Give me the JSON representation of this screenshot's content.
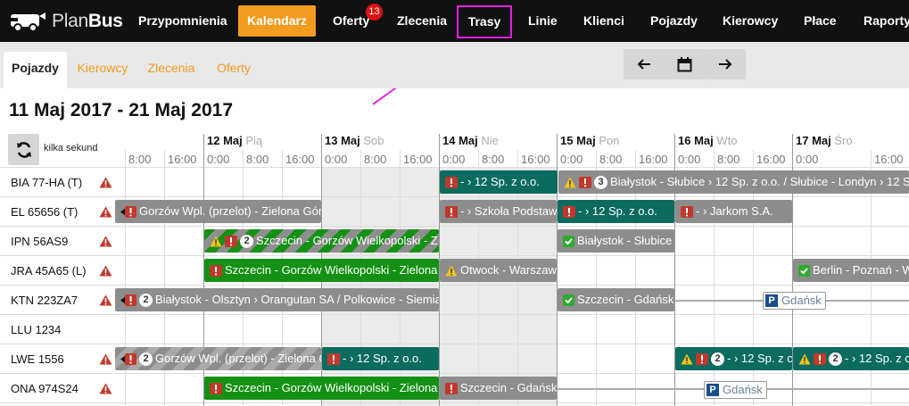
{
  "app": {
    "logo_light": "Plan",
    "logo_bold": "Bus"
  },
  "nav": {
    "items": [
      "Przypomnienia",
      "Kalendarz",
      "Oferty",
      "Zlecenia",
      "Trasy",
      "Linie",
      "Klienci",
      "Pojazdy",
      "Kierowcy",
      "Płace",
      "Raporty"
    ],
    "active": "Kalendarz",
    "highlighted": "Trasy",
    "oferty_badge": "13"
  },
  "subtabs": [
    "Pojazdy",
    "Kierowcy",
    "Zlecenia",
    "Oferty"
  ],
  "controls": {
    "prev": "arrow-left-icon",
    "calendar": "calendar-icon",
    "next": "arrow-right-icon"
  },
  "range_title": "11 Maj 2017 - 21 Maj 2017",
  "refresh_label": "kilka sekund",
  "days": [
    {
      "date": "12 Maj",
      "dow": "Pią"
    },
    {
      "date": "13 Maj",
      "dow": "Sob"
    },
    {
      "date": "14 Maj",
      "dow": "Nie"
    },
    {
      "date": "15 Maj",
      "dow": "Pon"
    },
    {
      "date": "16 Maj",
      "dow": "Wto"
    },
    {
      "date": "17 Maj",
      "dow": "Śro"
    }
  ],
  "times": [
    "8:00",
    "16:00",
    "0:00",
    "8:00",
    "16:00",
    "0:00",
    "8:00",
    "16:00",
    "0:00",
    "8:00",
    "16:00",
    "0:00",
    "8:00",
    "16:00",
    "0:00",
    "8:00",
    "16:00",
    "0:00",
    "16:00"
  ],
  "vehicles": [
    "BIA 77-HA (T)",
    "EL 65656 (T)",
    "IPN 56AS9",
    "JRA 45A65 (L)",
    "KTN 223ZA7",
    "LLU 1234",
    "LWE 1556",
    "ONA 974S24"
  ],
  "bars": [
    {
      "text": "- › 12 Sp. z o.o.",
      "count": ""
    },
    {
      "text": "Białystok - Słubice › 12 Sp. z o.o. / Słubice - Londyn › 12 Sp",
      "count": "3"
    },
    {
      "text": "Gorzów Wpl. (przelot) - Zielona Góra",
      "count": ""
    },
    {
      "text": "- › Szkoła Podstaw",
      "count": ""
    },
    {
      "text": "- › 12 Sp. z o.o.",
      "count": ""
    },
    {
      "text": "- › Jarkom S.A.",
      "count": ""
    },
    {
      "text": "Szczecin - Gorzów Wielkopolski - Z",
      "count": "2"
    },
    {
      "text": "Białystok - Słubice",
      "count": ""
    },
    {
      "text": "Szczecin - Gorzów Wielkopolski - Zielona",
      "count": ""
    },
    {
      "text": "Otwock - Warszaw",
      "count": ""
    },
    {
      "text": "Berlin - Poznań - W",
      "count": ""
    },
    {
      "text": "Białystok - Olsztyn › Orangutan SA / Polkowice - Siemia",
      "count": "2"
    },
    {
      "text": "Szczecin - Gdańsk",
      "count": ""
    },
    {
      "text": "Gorzów Wpl. (przelot) - Zielona G",
      "count": "2"
    },
    {
      "text": "- › 12 Sp. z o.o.",
      "count": ""
    },
    {
      "text": "- › 12 Sp. z c",
      "count": "2"
    },
    {
      "text": "- › 12 Sp. z c",
      "count": "2"
    },
    {
      "text": "Szczecin - Gorzów Wielkopolski - Zielona",
      "count": ""
    },
    {
      "text": "Szczecin - Gdańsk",
      "count": ""
    }
  ],
  "parking": [
    "Gdańsk",
    "Gdańsk"
  ],
  "parking_letter": "P",
  "colors": {
    "nav_active": "#f29b1f",
    "highlight": "#e61de6",
    "teal": "#0c6b5f",
    "green": "#149114",
    "gray": "#8d8d8d",
    "alert": "#c0392b"
  }
}
